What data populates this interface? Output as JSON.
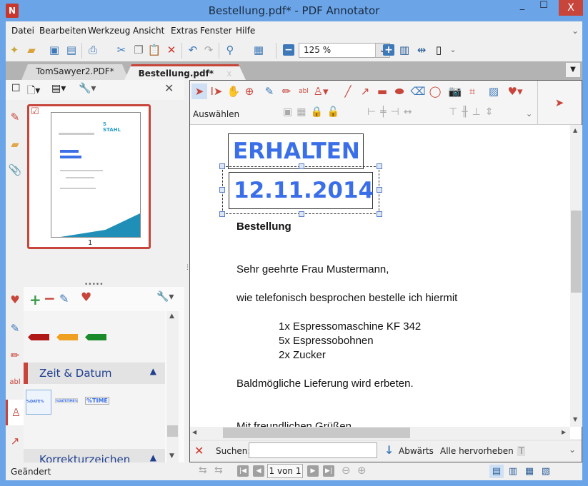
{
  "window": {
    "title": "Bestellung.pdf* - PDF Annotator",
    "minimize": "_",
    "maximize": "☐",
    "close": "X"
  },
  "menu": [
    "Datei",
    "Bearbeiten",
    "Werkzeug",
    "Ansicht",
    "Extras",
    "Fenster",
    "Hilfe"
  ],
  "toolbar": {
    "zoom_value": "125 %"
  },
  "tabs": [
    {
      "label": "TomSawyer2.PDF*",
      "active": false
    },
    {
      "label": "Bestellung.pdf*",
      "active": true,
      "close": "x"
    }
  ],
  "left_panel": {
    "thumbnail_page_label": "1",
    "sections": [
      "Zeit & Datum",
      "Korrekturzeichen"
    ],
    "stamp_previews": [
      "%DATE%",
      "%DATETIME%",
      "%TIME"
    ]
  },
  "annotation_bar": {
    "mode_label": "Auswählen"
  },
  "document": {
    "stamps": [
      "ERHALTEN",
      "12.11.2014"
    ],
    "heading": "Bestellung",
    "greeting": "Sehr geehrte Frau Mustermann,",
    "intro": "wie telefonisch besprochen bestelle ich hiermit",
    "items": [
      "1x Espressomaschine KF 342",
      "5x Espressobohnen",
      "2x Zucker"
    ],
    "closing": "Baldmögliche Lieferung wird erbeten.",
    "signoff": "Mit freundlichen Grüßen"
  },
  "search": {
    "label": "Suchen:",
    "value": "",
    "direction": "Abwärts",
    "highlight_all": "Alle hervorheben",
    "font_toggle": "T"
  },
  "status": {
    "text": "Geändert",
    "page_indicator": "1 von 1"
  },
  "colors": {
    "accent": "#c7453a",
    "frame": "#6ba5e7",
    "stamp_text": "#3a6fe8",
    "section_text": "#1f3f8f"
  }
}
